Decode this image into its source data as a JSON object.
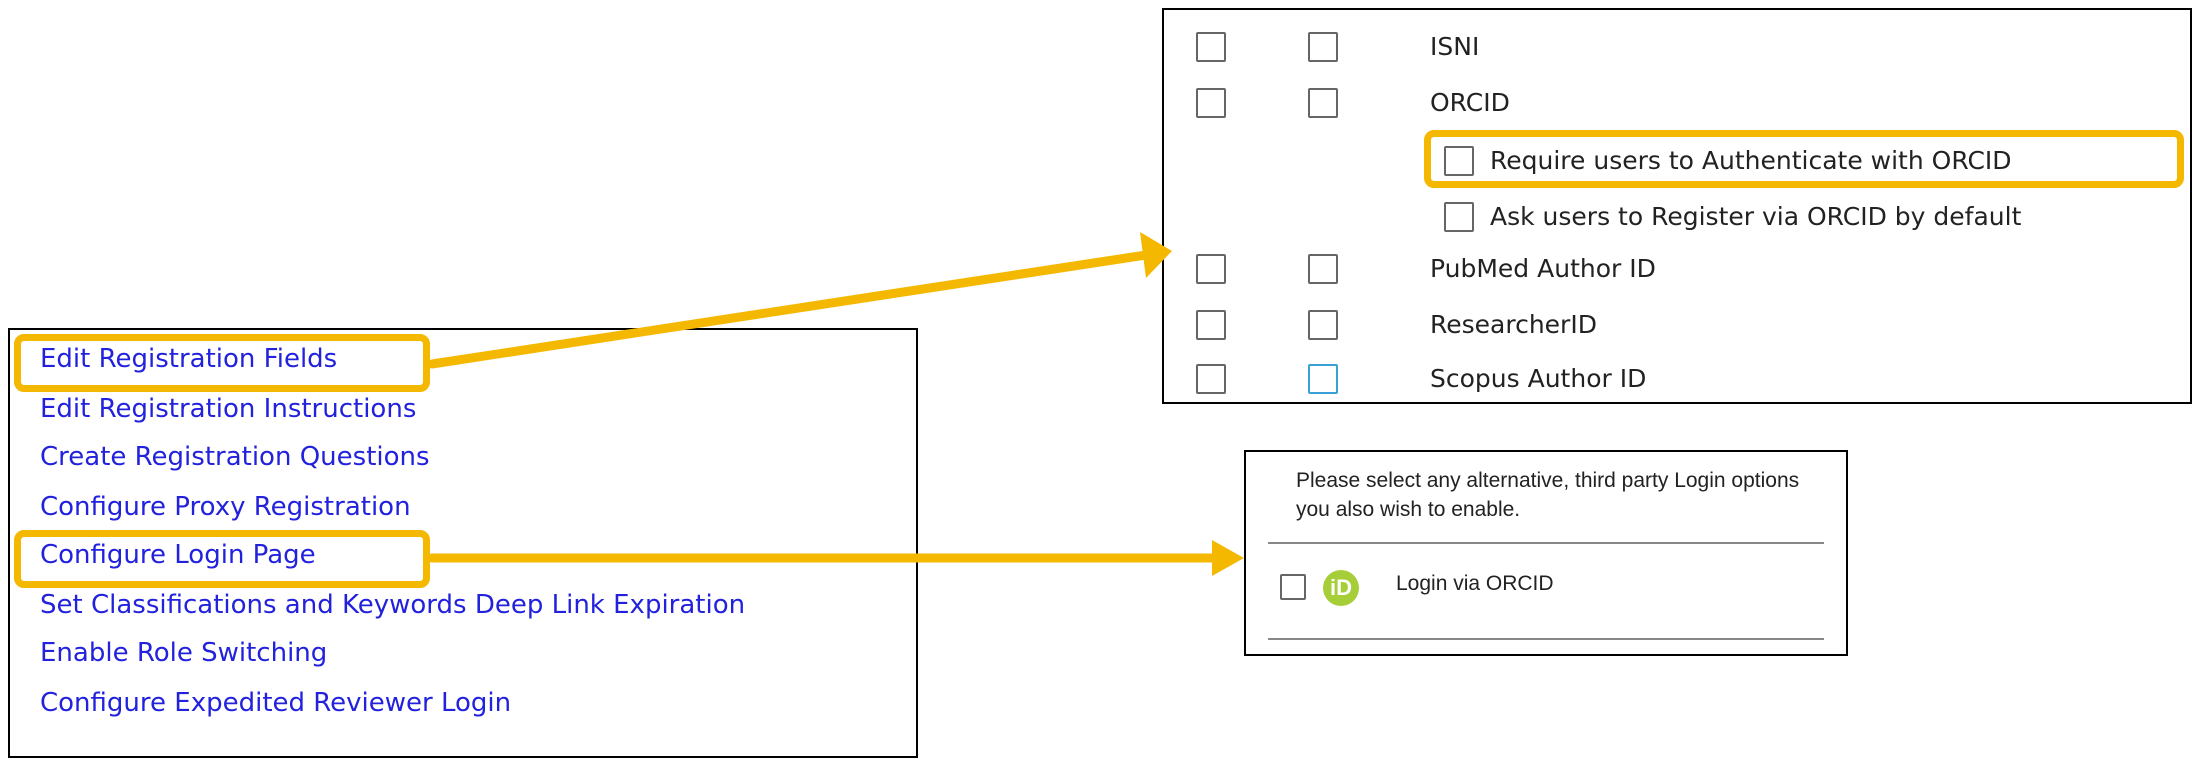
{
  "menu": {
    "items": [
      {
        "label": "Edit Registration Fields"
      },
      {
        "label": "Edit Registration Instructions"
      },
      {
        "label": "Create Registration Questions"
      },
      {
        "label": "Configure Proxy Registration"
      },
      {
        "label": "Configure Login Page"
      },
      {
        "label": "Set Classifications and Keywords Deep Link Expiration"
      },
      {
        "label": "Enable Role Switching"
      },
      {
        "label": "Configure Expedited Reviewer Login"
      }
    ]
  },
  "fields": {
    "rows": [
      {
        "label": "ISNI"
      },
      {
        "label": "ORCID"
      },
      {
        "label": "PubMed Author ID"
      },
      {
        "label": "ResearcherID"
      },
      {
        "label": "Scopus Author ID"
      }
    ],
    "orcid_options": [
      {
        "label": "Require users to Authenticate with ORCID"
      },
      {
        "label": "Ask users to Register via ORCID by default"
      }
    ]
  },
  "login": {
    "instructions": "Please select any alternative, third party Login options you also wish to enable.",
    "logo_text": "iD",
    "option_label": "Login via ORCID"
  },
  "colors": {
    "highlight": "#f5b800",
    "link": "#2222dd",
    "orcid_green": "#a6ce39"
  }
}
